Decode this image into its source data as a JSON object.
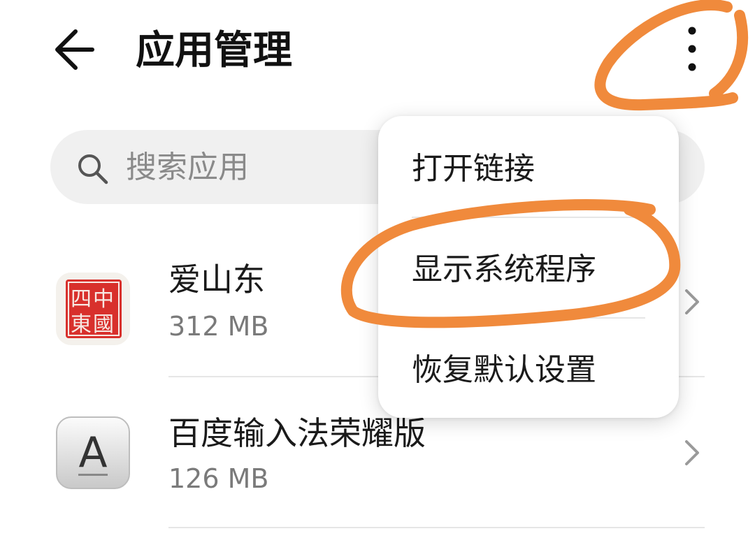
{
  "header": {
    "title": "应用管理",
    "back_icon": "arrow-left-icon",
    "more_icon": "more-vertical-icon"
  },
  "search": {
    "placeholder": "搜索应用",
    "value": "",
    "icon": "search-icon"
  },
  "apps": [
    {
      "name": "爱山东",
      "size": "312 MB",
      "icon": "seal-app-icon",
      "icon_seal_text": [
        "中",
        "國",
        "四",
        "東"
      ]
    },
    {
      "name": "百度输入法荣耀版",
      "size": "126 MB",
      "icon": "letter-a-app-icon",
      "icon_letter": "A"
    }
  ],
  "menu": {
    "items": [
      {
        "label": "打开链接"
      },
      {
        "label": "显示系统程序"
      },
      {
        "label": "恢复默认设置"
      }
    ]
  },
  "colors": {
    "annotation": "#F08A3C",
    "seal_red": "#D8302C",
    "search_bg": "#F0F0F0",
    "secondary_text": "#7A7A7A"
  }
}
